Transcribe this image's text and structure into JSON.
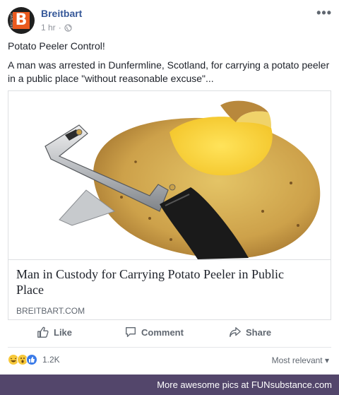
{
  "post": {
    "page_name": "Breitbart",
    "time": "1 hr",
    "dot": "·",
    "more": "•••",
    "title": "Potato Peeler Control!",
    "text": "A man was arrested in Dunfermline, Scotland, for carrying a potato peeler in a public place \"without reasonable excuse\"..."
  },
  "avatar": {
    "letter": "B",
    "side_text": "BREITBART"
  },
  "card": {
    "headline": "Man in Custody for Carrying Potato Peeler in Public Place",
    "domain": "BREITBART.COM"
  },
  "actions": {
    "like": "Like",
    "comment": "Comment",
    "share": "Share"
  },
  "reactions": {
    "count": "1.2K",
    "types": [
      "haha",
      "wow",
      "like"
    ]
  },
  "sort": {
    "label": "Most relevant",
    "caret": "▾"
  },
  "footer": {
    "text": "More awesome pics at FUNsubstance.com"
  },
  "colors": {
    "link": "#365899",
    "brand_orange": "#ea5a1f",
    "footer_bg": "#53466b",
    "like_blue": "#3b7be8"
  }
}
